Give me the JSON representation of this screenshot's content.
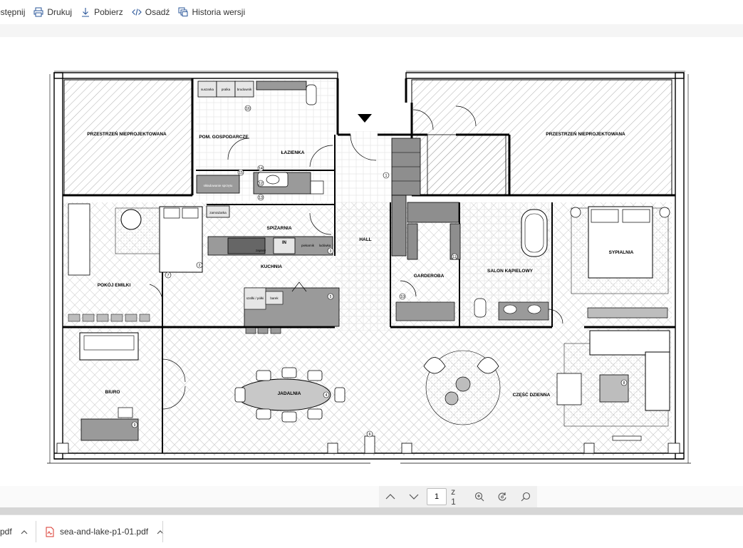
{
  "toolbar": {
    "items": [
      {
        "label": "ostępnij",
        "icon": "share-icon"
      },
      {
        "label": "Drukuj",
        "icon": "print-icon"
      },
      {
        "label": "Pobierz",
        "icon": "download-icon"
      },
      {
        "label": "Osadź",
        "icon": "embed-icon"
      },
      {
        "label": "Historia wersji",
        "icon": "version-history-icon"
      }
    ]
  },
  "plan": {
    "rooms": {
      "unplanned_left": "PRZESTRZEŃ NIEPROJEKTOWANA",
      "unplanned_right": "PRZESTRZEŃ NIEPROJEKTOWANA",
      "utility": "POM. GOSPODARCZE",
      "bathroom": "ŁAZIENKA",
      "pantry": "SPIŻARNIA",
      "hall": "HALL",
      "kitchen": "KUCHNIA",
      "kids_room": "POKÓJ EMILKI",
      "wardrobe": "GARDEROBA",
      "bath_salon": "SALON KĄPIELOWY",
      "bedroom": "SYPIALNIA",
      "office": "BIURO",
      "dining": "JADALNIA",
      "living": "CZĘŚĆ DZIENNA"
    },
    "fixtures": {
      "dryer": "suszarka",
      "washer": "pralka",
      "sink": "brudownik",
      "freezer": "zamrażarka",
      "stock": "zapasy",
      "fridge": "piekarnik",
      "microwave": "lodówka",
      "in": "IN",
      "cabinets": "szafki / półki",
      "bar": "barek",
      "storage": "składowanie sprzętu"
    },
    "tags": [
      "16",
      "15",
      "14",
      "13",
      "12",
      "7",
      "2",
      "1",
      "3",
      "4",
      "5",
      "6",
      "8",
      "9",
      "10",
      "11"
    ]
  },
  "pagination": {
    "current_page": "1",
    "of_label": "z 1"
  },
  "downloads": [
    {
      "name": "pdf"
    },
    {
      "name": "sea-and-lake-p1-01.pdf"
    }
  ],
  "colors": {
    "accent": "#2b579a",
    "pdf_red": "#d9342b",
    "wall": "#000000",
    "grey_fill": "#9a9a9a"
  }
}
